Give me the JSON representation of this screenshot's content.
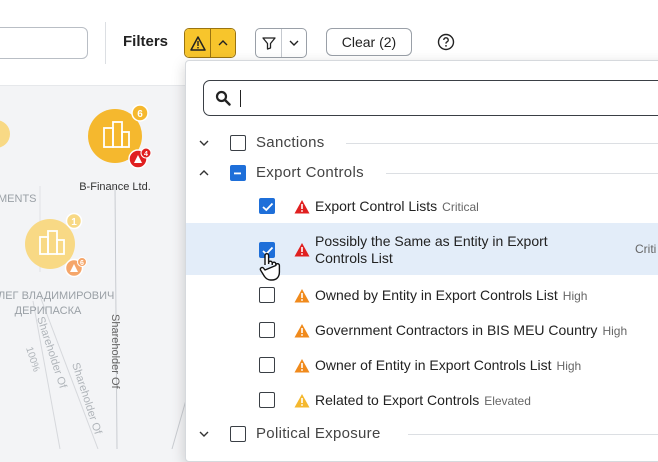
{
  "toolbar": {
    "filters_label": "Filters",
    "clear_label": "Clear (2)",
    "icons": {
      "warning_toggle": "warning-triangle-icon",
      "funnel": "funnel-icon",
      "help": "question-circle-icon"
    },
    "colors": {
      "warning_active": "#f7c52c"
    }
  },
  "graph": {
    "nodes": [
      {
        "label": "B-Finance Ltd.",
        "badge_count": "6",
        "alert_count": "4"
      },
      {
        "label": "",
        "badge_count": "1",
        "alert_count": "6"
      }
    ],
    "left_partial_label": "MENTS",
    "person_label_line1": "ЛЕГ ВЛАДИМИРОВИЧ",
    "person_label_line2": "ДЕРИПАСКА",
    "edges": [
      {
        "label": "Shareholder Of",
        "share": "100%"
      },
      {
        "label": "Shareholder Of"
      },
      {
        "label": "Shareholder Of"
      }
    ],
    "colors": {
      "node": "#f5b82e",
      "node_faded": "#f8d985",
      "alert": "#e02020"
    }
  },
  "dropdown": {
    "search": {
      "value": ""
    },
    "groups": [
      {
        "label": "Sanctions",
        "expanded": false,
        "state": "unchecked"
      },
      {
        "label": "Export Controls",
        "expanded": true,
        "state": "indeterminate",
        "items": [
          {
            "label": "Export Control Lists",
            "severity": "Critical",
            "checked": true
          },
          {
            "label_line1": "Possibly the Same as Entity in Export",
            "label_line2": "Controls List",
            "severity": "Criti",
            "checked": true,
            "hovered": true
          },
          {
            "label": "Owned by Entity in Export Controls List",
            "severity": "High",
            "checked": false
          },
          {
            "label": "Government Contractors in BIS MEU Country",
            "severity": "High",
            "checked": false
          },
          {
            "label": "Owner of Entity in Export Controls List",
            "severity": "High",
            "checked": false
          },
          {
            "label": "Related to Export Controls",
            "severity": "Elevated",
            "checked": false
          }
        ]
      },
      {
        "label": "Political Exposure",
        "expanded": false,
        "state": "unchecked"
      }
    ],
    "colors": {
      "critical": "#e02020",
      "high": "#f08a1c",
      "elevated": "#f5b82e",
      "checkbox": "#1e6fd9",
      "hover_row": "#e3edf9"
    }
  }
}
